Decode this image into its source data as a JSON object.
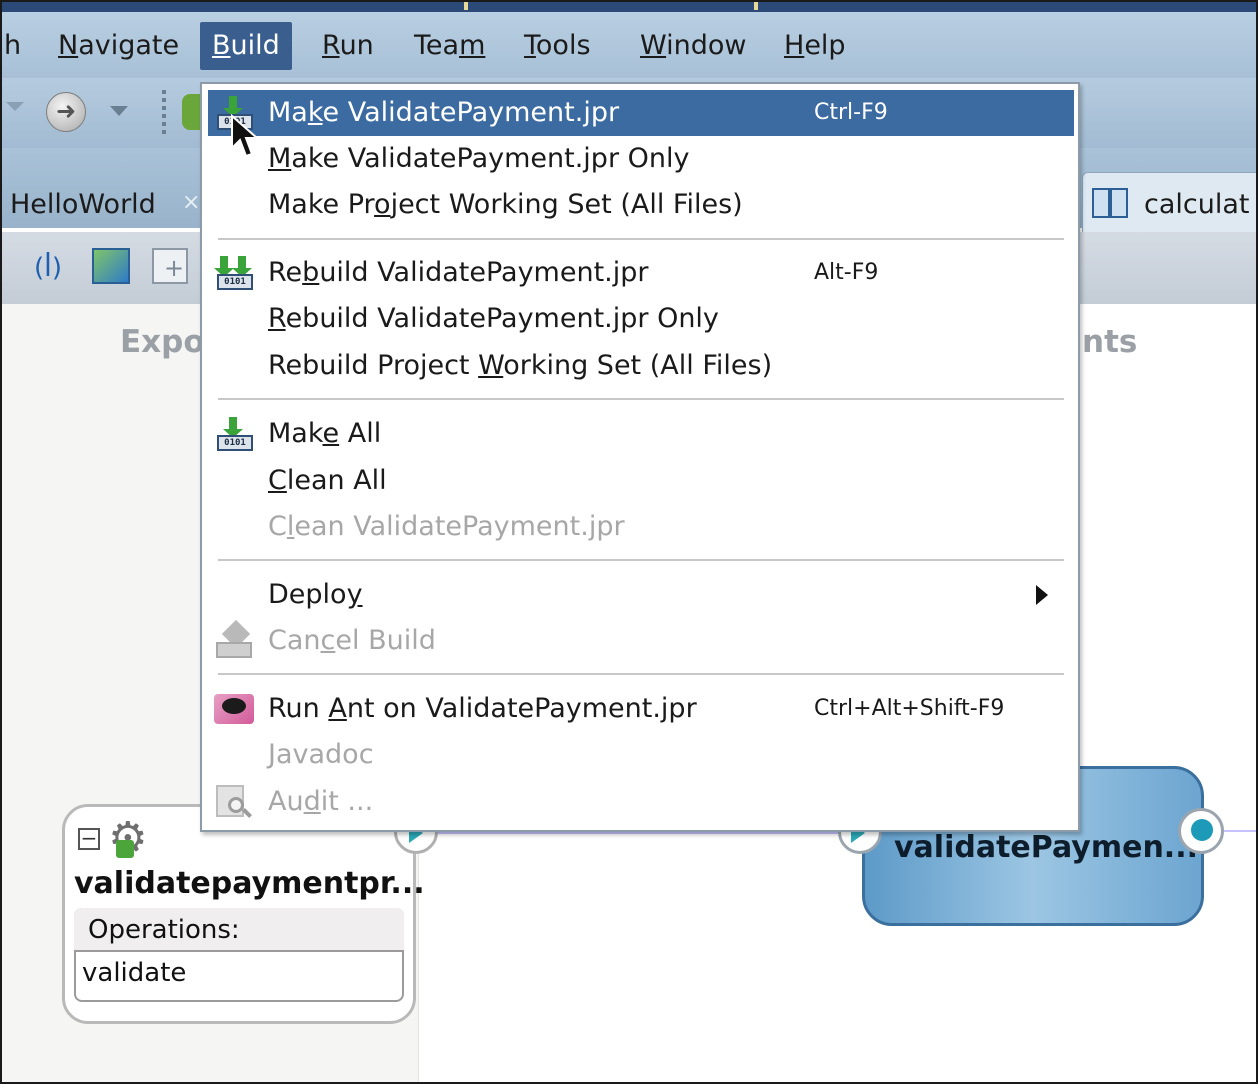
{
  "menubar": {
    "items": [
      {
        "label": "h"
      },
      {
        "label": "Navigate"
      },
      {
        "label": "Build"
      },
      {
        "label": "Run"
      },
      {
        "label": "Team"
      },
      {
        "label": "Tools"
      },
      {
        "label": "Window"
      },
      {
        "label": "Help"
      }
    ]
  },
  "tabs": {
    "hello": "HelloWorld",
    "calc": "calculat"
  },
  "canvas": {
    "lane_left_title": "Expo",
    "lane_right_title": "nts",
    "service": {
      "name": "validatepaymentpr...",
      "operations_header": "Operations:",
      "operation": "validate"
    },
    "component": {
      "name": "validatePaymen..."
    }
  },
  "build_menu": {
    "items": [
      {
        "label": "Make ValidatePayment.jpr",
        "shortcut": "Ctrl-F9",
        "icon": "make-icon",
        "enabled": true,
        "selected": true
      },
      {
        "label": "Make ValidatePayment.jpr Only",
        "shortcut": "",
        "enabled": true
      },
      {
        "label": "Make Project Working Set (All Files)",
        "shortcut": "",
        "enabled": true
      },
      {
        "label": "Rebuild ValidatePayment.jpr",
        "shortcut": "Alt-F9",
        "icon": "rebuild-icon",
        "enabled": true
      },
      {
        "label": "Rebuild ValidatePayment.jpr Only",
        "shortcut": "",
        "enabled": true
      },
      {
        "label": "Rebuild Project Working Set (All Files)",
        "shortcut": "",
        "enabled": true
      },
      {
        "label": "Make All",
        "shortcut": "",
        "icon": "make-all-icon",
        "enabled": true
      },
      {
        "label": "Clean All",
        "shortcut": "",
        "enabled": true
      },
      {
        "label": "Clean ValidatePayment.jpr",
        "shortcut": "",
        "enabled": false
      },
      {
        "label": "Deploy",
        "shortcut": "",
        "enabled": true,
        "submenu": true
      },
      {
        "label": "Cancel Build",
        "shortcut": "",
        "icon": "cancel-build-icon",
        "enabled": false
      },
      {
        "label": "Run Ant on ValidatePayment.jpr",
        "shortcut": "Ctrl+Alt+Shift-F9",
        "icon": "ant-icon",
        "enabled": true
      },
      {
        "label": "Javadoc",
        "shortcut": "",
        "enabled": false
      },
      {
        "label": "Audit ...",
        "shortcut": "",
        "icon": "audit-icon",
        "enabled": false
      }
    ]
  },
  "colors": {
    "menu_selection": "#3b6ba0",
    "menubar": "#b9cfe2",
    "disabled_text": "#a7a7a7",
    "component_fill": "#7fb3d9"
  }
}
